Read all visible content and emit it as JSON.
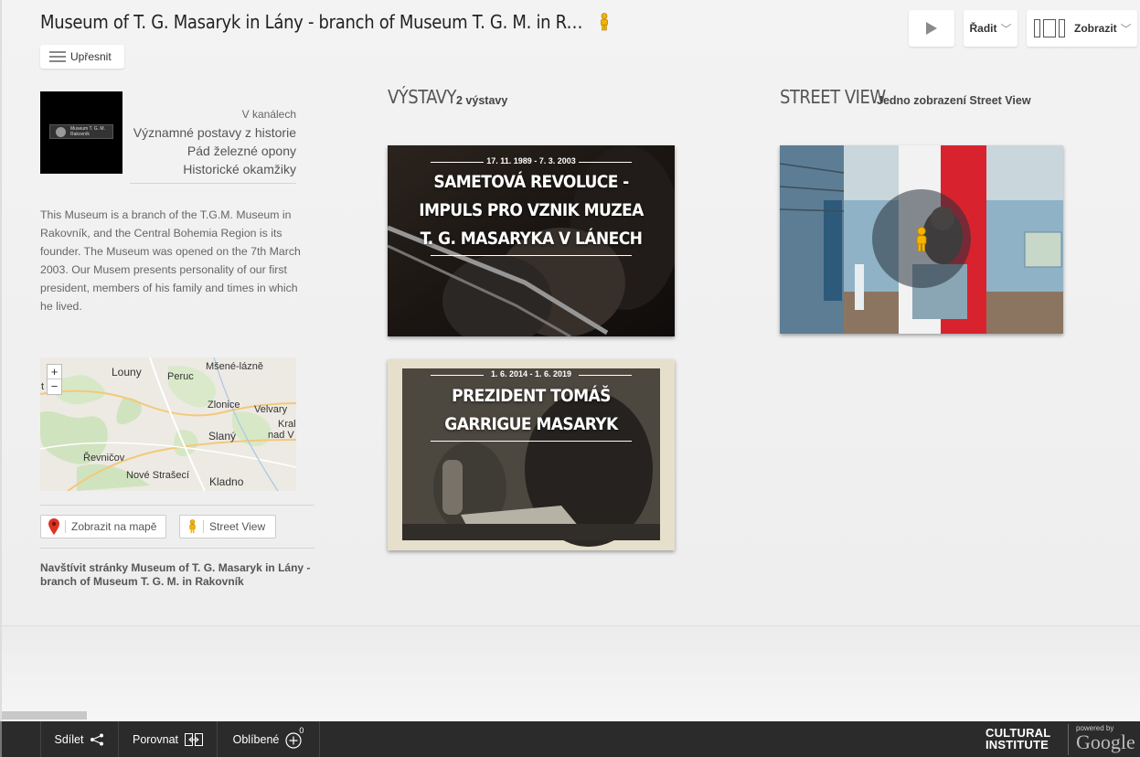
{
  "header": {
    "title": "Museum of T. G. Masaryk in Lány - branch of Museum T. G. M. in Rakovník",
    "refine_label": "Upřesnit",
    "sort_label": "Řadit",
    "view_label": "Zobrazit"
  },
  "sidebar": {
    "thumb_text": "Museum T. G. M. Rakovník",
    "channels_label": "V kanálech",
    "channels": [
      "Významné postavy z historie",
      "Pád železné opony",
      "Historické okamžiky"
    ],
    "description": "This Museum is a branch of the T.G.M. Museum in Rakovník, and the Central Bohemia Region is its founder. The Museum was opened on the 7th March 2003. Our Musem presents personality of our first president, members of his family and times in which he lived.",
    "map": {
      "zoom_in": "+",
      "zoom_out": "−",
      "places": [
        "Louny",
        "Peruc",
        "Mšené-lázně",
        "Zlonice",
        "Velvary",
        "Kral",
        "nad V",
        "Slaný",
        "Řevničov",
        "Nové Strašecí",
        "Kladno",
        "t"
      ]
    },
    "show_on_map": "Zobrazit na mapě",
    "street_view": "Street View",
    "visit_link": "Navštívit stránky Museum of T. G. Masaryk in Lány - branch of Museum T. G. M. in Rakovník"
  },
  "exhibitions": {
    "heading": "VÝSTAVY",
    "count": "2 výstavy",
    "items": [
      {
        "date": "17. 11. 1989 - 7. 3. 2003",
        "title_lines": [
          "SAMETOVÁ REVOLUCE -",
          "IMPULS PRO VZNIK MUZEA",
          "T. G. MASARYKA V LÁNECH"
        ]
      },
      {
        "date": "1. 6. 2014 - 1. 6. 2019",
        "title_lines": [
          "PREZIDENT TOMÁŠ",
          "GARRIGUE MASARYK"
        ]
      }
    ]
  },
  "streetview": {
    "heading": "STREET VIEW",
    "count": "Jedno zobrazení Street View"
  },
  "footer": {
    "share": "Sdílet",
    "compare": "Porovnat",
    "favorites": "Oblíbené",
    "favorites_count": "0",
    "logo_line1": "CULTURAL",
    "logo_line2": "INSTITUTE",
    "powered_by": "powered by",
    "google": "Google"
  },
  "colors": {
    "pegman": "#f5b400",
    "marker": "#dd3322",
    "footer_bg": "#2b2b2b"
  }
}
